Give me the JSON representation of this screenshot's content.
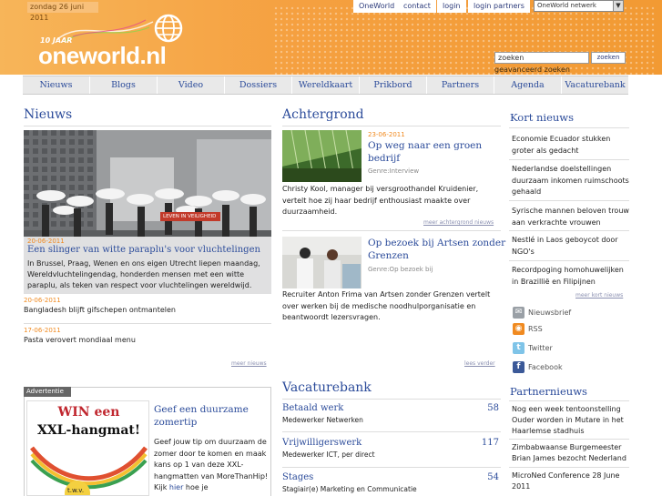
{
  "header": {
    "date": "zondag 26 juni 2011",
    "logo_top": "10 JAAR",
    "logo": "oneworld.nl",
    "links": [
      "OneWorld",
      "contact",
      "login",
      "login partners"
    ],
    "network_select": "OneWorld netwerk",
    "search_placeholder": "zoeken",
    "search_button": "zoeken",
    "advanced_search": "geavanceerd zoeken"
  },
  "nav": [
    "Nieuws",
    "Blogs",
    "Video",
    "Dossiers",
    "Wereldkaart",
    "Prikbord",
    "Partners",
    "Agenda",
    "Vacaturebank"
  ],
  "news": {
    "title": "Nieuws",
    "banner_text": "LEVEN IN VEILIGHEID",
    "featured_date": "20-06-2011",
    "featured_headline": "Een slinger van witte paraplu's voor vluchtelingen",
    "featured_text": "In Brussel, Praag, Wenen en ons eigen Utrecht liepen maandag, Wereldvluchtelingendag, honderden mensen met een witte paraplu, als teken van respect voor vluchtelingen wereldwijd.",
    "items": [
      {
        "date": "20-06-2011",
        "title": "Bangladesh blijft gifschepen ontmantelen"
      },
      {
        "date": "17-06-2011",
        "title": "Pasta verovert mondiaal menu"
      }
    ],
    "more": "meer nieuws"
  },
  "achtergrond": {
    "title": "Achtergrond",
    "items": [
      {
        "date": "23-06-2011",
        "title": "Op weg naar een groen bedrijf",
        "genre": "Genre:Interview",
        "text": "Christy Kool, manager bij versgroothandel Kruidenier, vertelt hoe zij haar bedrijf enthousiast maakte over duurzaamheid."
      },
      {
        "date": "",
        "title": "Op bezoek bij Artsen zonder Grenzen",
        "genre": "Genre:Op bezoek bij",
        "text": "Recruiter Anton Frima van Artsen zonder Grenzen vertelt over werken bij de medische noodhulporganisatie en beantwoordt lezersvragen."
      }
    ],
    "more1": "meer achtergrond nieuws",
    "more2": "lees verder"
  },
  "kort_nieuws": {
    "title": "Kort nieuws",
    "items": [
      "Economie Ecuador stukken groter als gedacht",
      "Nederlandse doelstellingen duurzaam inkomen ruimschoots gehaald",
      "Syrische mannen beloven trouw aan verkrachte vrouwen",
      "Nestlé in Laos geboycot door NGO's",
      "Recordpoging homohuwelijken in Brazillië en Filipijnen"
    ],
    "more": "meer kort nieuws"
  },
  "social": [
    {
      "label": "Nieuwsbrief",
      "icon": "mail-icon"
    },
    {
      "label": "RSS",
      "icon": "rss-icon"
    },
    {
      "label": "Twitter",
      "icon": "twitter-icon"
    },
    {
      "label": "Facebook",
      "icon": "facebook-icon"
    }
  ],
  "ad": {
    "tag": "Advertentie",
    "img_line1": "WIN een",
    "img_line2": "XXL-hangmat!",
    "img_badge": "t.w.v.",
    "headline": "Geef een duurzame zomertip",
    "text_before": "Geef jouw tip om duurzaam de zomer door te komen en maak kans op 1 van deze XXL-hangmatten van MoreThanHip! Kijk ",
    "link": "hier",
    "text_after": " hoe je"
  },
  "vacaturebank": {
    "title": "Vacaturebank",
    "rows": [
      {
        "category": "Betaald werk",
        "count": "58",
        "job": "Medewerker Netwerken"
      },
      {
        "category": "Vrijwilligerswerk",
        "count": "117",
        "job": "Medewerker ICT, per direct"
      },
      {
        "category": "Stages",
        "count": "54",
        "job": "Stagiair(e) Marketing en Communicatie"
      }
    ]
  },
  "partnernieuws": {
    "title": "Partnernieuws",
    "items": [
      "Nog een week tentoonstelling Ouder worden in Mutare in het Haarlemse stadhuis",
      "Zimbabwaanse Burgemeester Brian James bezocht Nederland",
      "MicroNed Conference 28 June 2011"
    ]
  },
  "colors": {
    "orange": "#f4a23c",
    "blue": "#2b4b9a",
    "date_orange": "#f08a20"
  }
}
